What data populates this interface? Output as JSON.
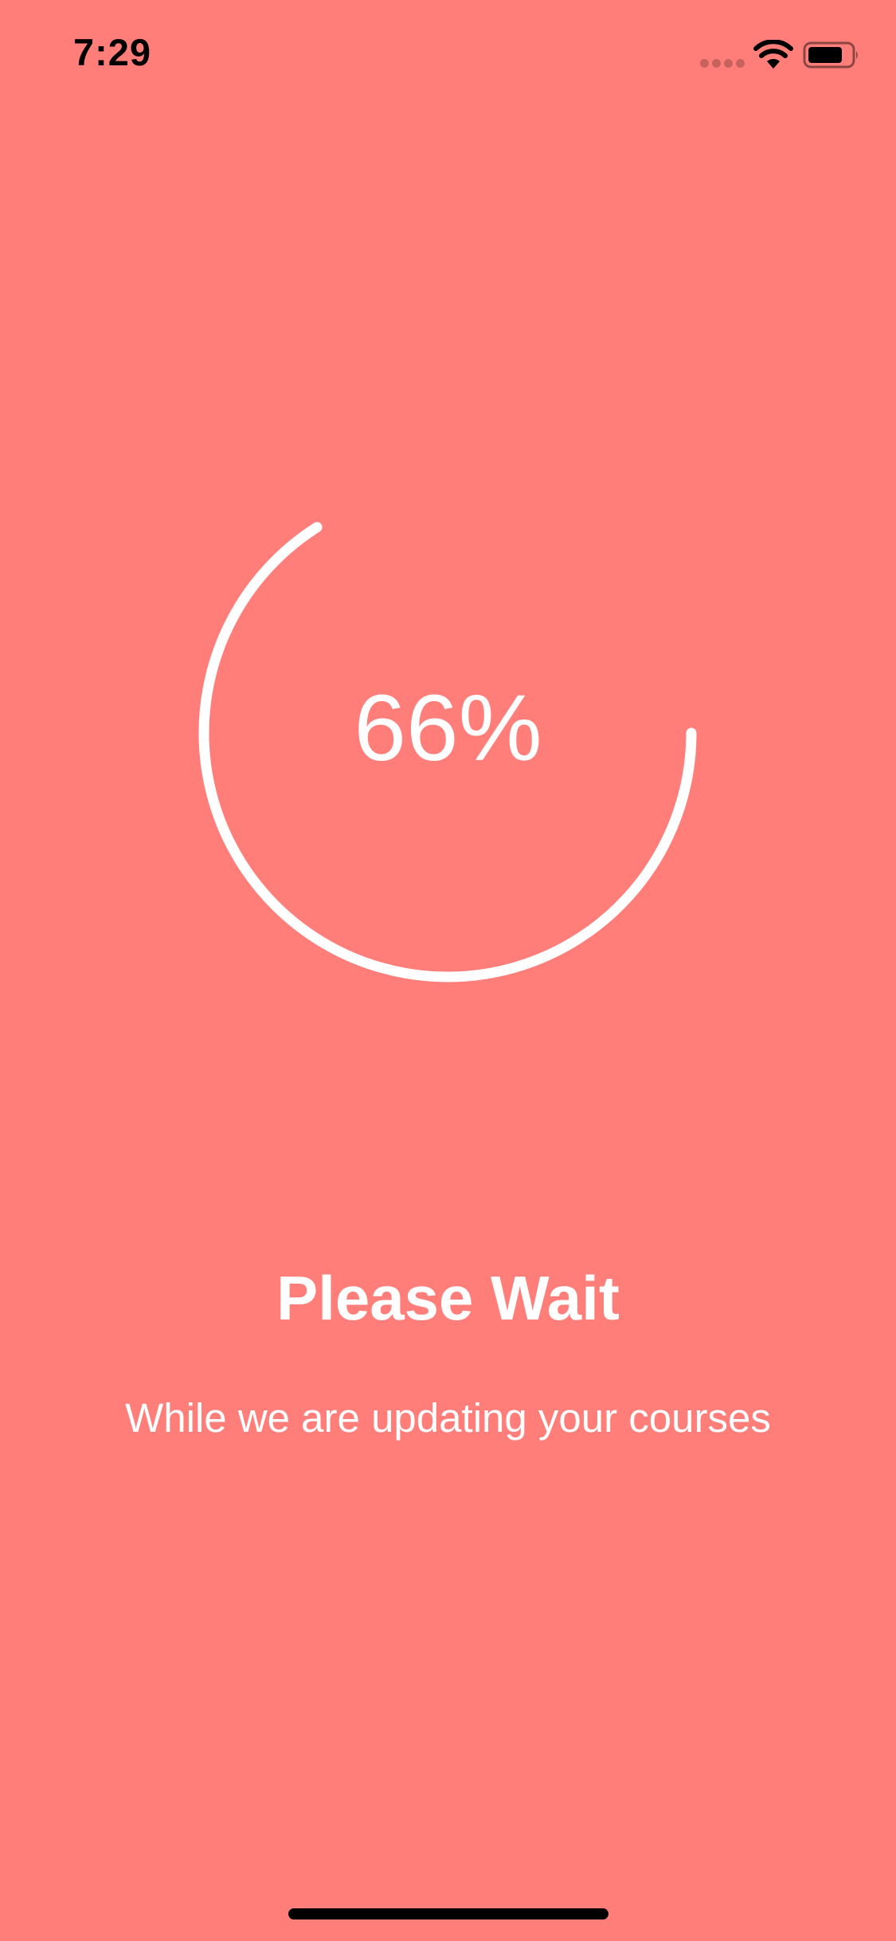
{
  "status_bar": {
    "time": "7:29"
  },
  "progress": {
    "value": 0.66,
    "label": "66%"
  },
  "message": {
    "title": "Please Wait",
    "subtitle": "While we are updating your courses"
  },
  "colors": {
    "background": "#FF7E79",
    "ring": "#FFFFFF",
    "text": "#FFFFFF",
    "status_text": "#000000"
  },
  "icons": {
    "signal": "cellular-signal-icon",
    "wifi": "wifi-icon",
    "battery": "battery-icon"
  }
}
